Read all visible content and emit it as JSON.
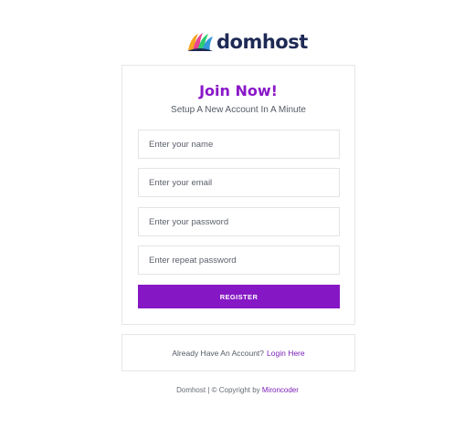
{
  "brand": {
    "name": "domhost"
  },
  "form": {
    "title": "Join Now!",
    "subtitle": "Setup A New Account In A Minute",
    "name_placeholder": "Enter your name",
    "email_placeholder": "Enter your email",
    "password_placeholder": "Enter your password",
    "repeat_password_placeholder": "Enter repeat password",
    "register_label": "REGISTER"
  },
  "login": {
    "prompt": "Already Have An Account?",
    "link_label": "Login Here"
  },
  "footer": {
    "text": "Domhost | © Copyright by",
    "author_link": "Mironcoder"
  },
  "colors": {
    "accent": "#8617c5",
    "brand_text": "#1e2a55"
  }
}
